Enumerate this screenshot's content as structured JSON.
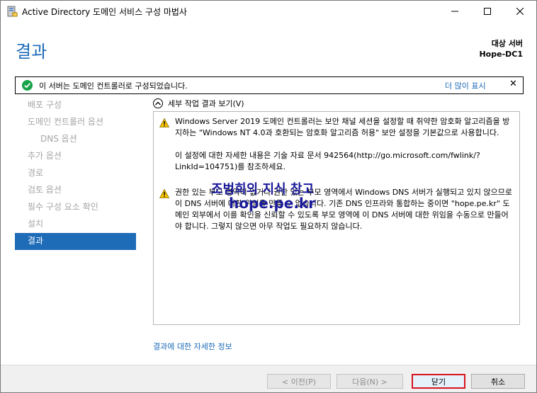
{
  "window": {
    "title": "Active Directory 도메인 서비스 구성 마법사"
  },
  "page": {
    "heading": "결과",
    "target_server_label": "대상 서버",
    "target_server_name": "Hope-DC1"
  },
  "notice": {
    "text": "이 서버는 도메인 컨트롤러로 구성되었습니다.",
    "more_link": "더 많이 표시",
    "close_glyph": "✕"
  },
  "nav": {
    "items": [
      {
        "label": "배포 구성"
      },
      {
        "label": "도메인 컨트롤러 옵션"
      },
      {
        "label": "DNS 옵션"
      },
      {
        "label": "추가 옵션"
      },
      {
        "label": "경로"
      },
      {
        "label": "검토 옵션"
      },
      {
        "label": "필수 구성 요소 확인"
      },
      {
        "label": "설치"
      },
      {
        "label": "결과"
      }
    ]
  },
  "details": {
    "toggle_label": "세부 작업 결과 보기(V)",
    "messages": [
      {
        "icon": "warning-icon",
        "paragraphs": [
          "Windows Server 2019 도메인 컨트롤러는 보안 채널 세션을 설정할 때 취약한 암호화 알고리즘을 방지하는 \"Windows NT 4.0과 호환되는 암호화 알고리즘 허용\" 보안 설정을 기본값으로 사용합니다.",
          "이 설정에 대한 자세한 내용은 기술 자료 문서 942564(http://go.microsoft.com/fwlink/?LinkId=104751)를 참조하세요."
        ]
      },
      {
        "icon": "warning-icon",
        "paragraphs": [
          "권한 있는 부모 영역이 없거나 권한 있는 부모 영역에서 Windows DNS 서버가 실행되고 있지 않으므로 이 DNS 서버에 대한 위임을 만들 수 없습니다. 기존 DNS 인프라와 통합하는 중이면 \"hope.pe.kr\" 도메인 외부에서 이를 확인을 신뢰할 수 있도록 부모 영역에 이 DNS 서버에 대한 위임을 수동으로 만들어야 합니다. 그렇지 않으면 아무 작업도 필요하지 않습니다."
        ]
      }
    ],
    "more_info_link": "결과에 대한 자세한 정보"
  },
  "watermark": {
    "line1": "조범희의 지식 창고",
    "line2": "hope.pe.kr"
  },
  "buttons": {
    "prev": "< 이전(P)",
    "next": "다음(N) >",
    "close": "닫기",
    "cancel": "취소"
  },
  "colors": {
    "accent": "#1e6bb8",
    "highlight_border": "#d8141e",
    "success": "#16a34a",
    "warning": "#f5c400"
  }
}
